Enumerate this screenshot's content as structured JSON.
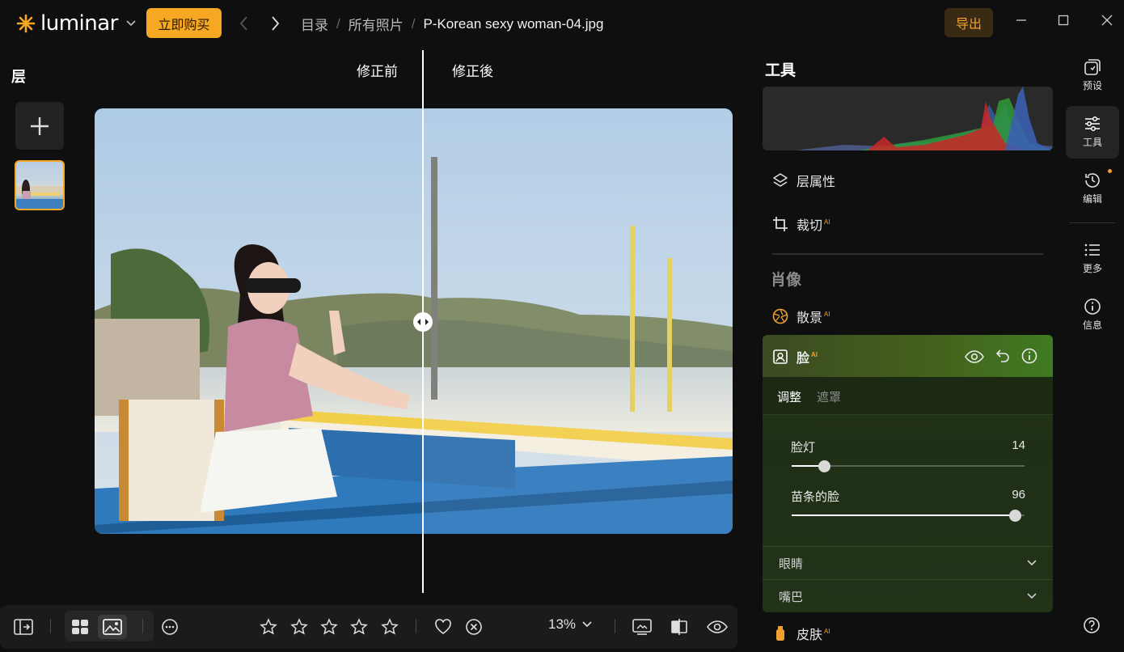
{
  "app": {
    "logo_text": "luminar",
    "buy_label": "立即购买",
    "export_label": "导出"
  },
  "breadcrumb": {
    "catalog": "目录",
    "all_photos": "所有照片",
    "file_name": "P-Korean sexy woman-04.jpg",
    "separator": "/"
  },
  "layers": {
    "title": "层"
  },
  "compare": {
    "before": "修正前",
    "after": "修正後"
  },
  "bottom_bar": {
    "zoom": "13%"
  },
  "tools": {
    "title": "工具",
    "layer_properties": "层属性",
    "crop": "裁切",
    "ai_badge": "AI",
    "portrait_section": "肖像",
    "bokeh": "散景",
    "face": {
      "title": "脸",
      "tab_adjust": "调整",
      "tab_mask": "遮罩",
      "sliders": [
        {
          "label": "脸灯",
          "value": "14",
          "fraction": 0.14
        },
        {
          "label": "苗条的脸",
          "value": "96",
          "fraction": 0.96
        }
      ],
      "eyes": "眼睛",
      "mouth": "嘴巴"
    },
    "skin": "皮肤"
  },
  "rail": {
    "presets": "预设",
    "tools": "工具",
    "edits": "编辑",
    "more": "更多",
    "info": "信息"
  },
  "colors": {
    "accent": "#f6a823",
    "face_header": "#45621c"
  }
}
